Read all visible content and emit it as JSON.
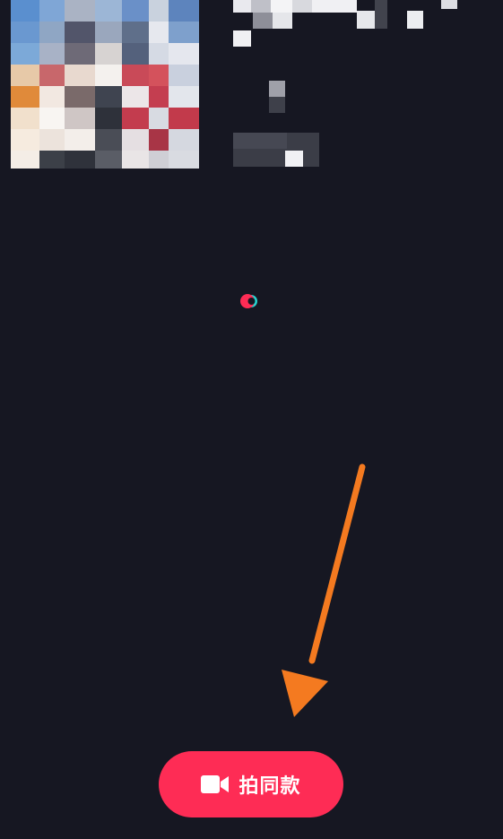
{
  "accent_color": "#fe2c55",
  "arrow_color": "#f47a20",
  "loader": {
    "icon": "loading-spinner-icon"
  },
  "shoot_same_button": {
    "icon": "video-camera-icon",
    "label": "拍同款"
  }
}
